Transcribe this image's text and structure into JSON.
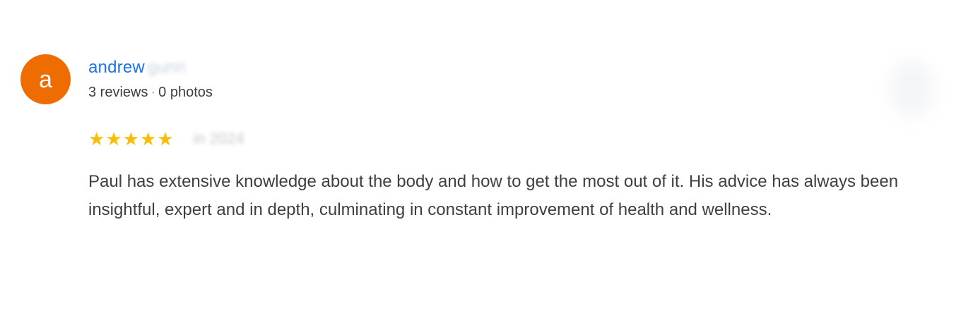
{
  "review": {
    "avatar_letter": "a",
    "avatar_color": "#ef6c00",
    "author_first_name": "andrew",
    "author_last_name_redacted": "gunn",
    "reviews_count": "3 reviews",
    "separator": "·",
    "photos_count": "0 photos",
    "rating": 5,
    "rating_max": 5,
    "stars": [
      "★",
      "★",
      "★",
      "★",
      "★"
    ],
    "star_color": "#fbbc04",
    "date_redacted": "in 2024",
    "text": "Paul has extensive knowledge about the body and how to get the most out of it. His advice has always been insightful, expert and in depth, culminating in constant improvement of health and wellness."
  },
  "colors": {
    "name_link": "#1a73e8",
    "body_text": "#3c4043"
  },
  "icons": {
    "star": "star-icon",
    "more": "more-options-icon"
  }
}
